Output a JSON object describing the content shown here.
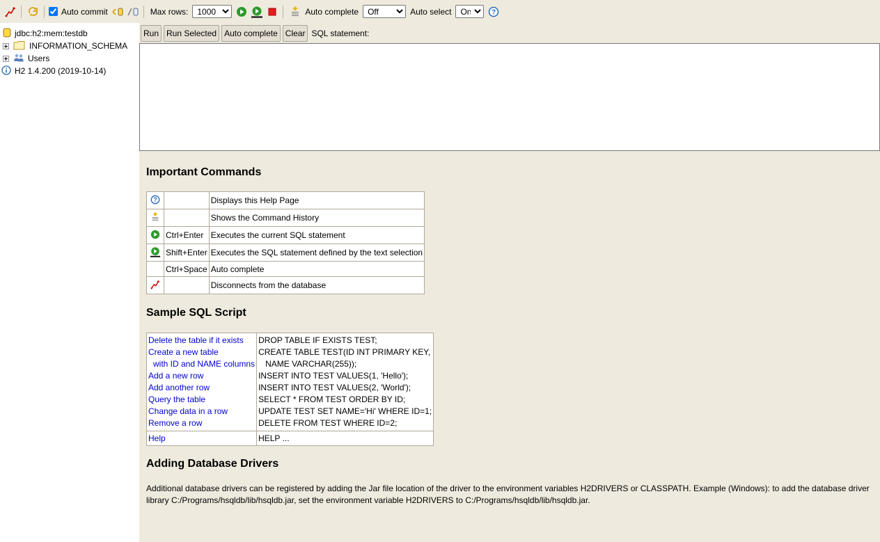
{
  "toolbar": {
    "auto_commit_label": "Auto commit",
    "max_rows_label": "Max rows:",
    "max_rows_value": "1000",
    "auto_complete_label": "Auto complete",
    "auto_complete_value": "Off",
    "auto_select_label": "Auto select",
    "auto_select_value": "On"
  },
  "tree": {
    "connection": "jdbc:h2:mem:testdb",
    "schema": "INFORMATION_SCHEMA",
    "users": "Users",
    "version": "H2 1.4.200 (2019-10-14)"
  },
  "buttons": {
    "run": "Run",
    "run_selected": "Run Selected",
    "auto_complete": "Auto complete",
    "clear": "Clear",
    "sql_label": "SQL statement:"
  },
  "help": {
    "important_title": "Important Commands",
    "commands": [
      {
        "icon": "help-icon",
        "key": "",
        "desc": "Displays this Help Page"
      },
      {
        "icon": "history-icon",
        "key": "",
        "desc": "Shows the Command History"
      },
      {
        "icon": "run-icon",
        "key": "Ctrl+Enter",
        "desc": "Executes the current SQL statement"
      },
      {
        "icon": "run-selected-icon",
        "key": "Shift+Enter",
        "desc": "Executes the SQL statement defined by the text selection"
      },
      {
        "icon": "",
        "key": "Ctrl+Space",
        "desc": "Auto complete"
      },
      {
        "icon": "disconnect-icon",
        "key": "",
        "desc": "Disconnects from the database"
      }
    ],
    "sample_title": "Sample SQL Script",
    "sample": {
      "links": [
        "Delete the table if it exists",
        "Create a new table",
        "with ID and NAME columns",
        "Add a new row",
        "Add another row",
        "Query the table",
        "Change data in a row",
        "Remove a row"
      ],
      "sql": [
        "DROP TABLE IF EXISTS TEST;",
        "CREATE TABLE TEST(ID INT PRIMARY KEY,",
        "NAME VARCHAR(255));",
        "INSERT INTO TEST VALUES(1, 'Hello');",
        "INSERT INTO TEST VALUES(2, 'World');",
        "SELECT * FROM TEST ORDER BY ID;",
        "UPDATE TEST SET NAME='Hi' WHERE ID=1;",
        "DELETE FROM TEST WHERE ID=2;"
      ],
      "help_link": "Help",
      "help_sql": "HELP ..."
    },
    "drivers_title": "Adding Database Drivers",
    "drivers_text": "Additional database drivers can be registered by adding the Jar file location of the driver to the environment variables H2DRIVERS or CLASSPATH. Example (Windows): to add the database driver library C:/Programs/hsqldb/lib/hsqldb.jar, set the environment variable H2DRIVERS to C:/Programs/hsqldb/lib/hsqldb.jar."
  }
}
